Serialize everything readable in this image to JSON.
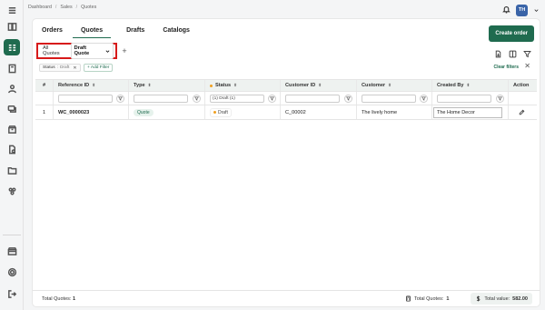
{
  "breadcrumb": {
    "items": [
      "Dashboard",
      "Sales",
      "Quotes"
    ]
  },
  "header": {
    "avatar_initials": "TH"
  },
  "tabs": [
    {
      "label": "Orders"
    },
    {
      "label": "Quotes"
    },
    {
      "label": "Drafts"
    },
    {
      "label": "Catalogs"
    }
  ],
  "create_button": "Create order",
  "views": {
    "all_label": "All Quotes",
    "selected_label": "Draft Quote"
  },
  "filters": {
    "chip_label": "Status",
    "chip_separator": ":",
    "chip_value": "Draft",
    "add_filter_label": "+ Add Filter",
    "clear_label": "Clear filters"
  },
  "table": {
    "columns": [
      "#",
      "Reference ID",
      "Type",
      "Status",
      "Customer ID",
      "Customer",
      "Created By",
      "Action"
    ],
    "status_filter_value": "(1) Draft (1)",
    "rows": [
      {
        "num": "1",
        "reference_id": "WC_0000023",
        "type": "Quote",
        "status": "Draft",
        "customer_id": "C_00002",
        "customer": "The lively home",
        "created_by": "The Home Decor"
      }
    ]
  },
  "footer": {
    "total_quotes_label": "Total Quotes:",
    "total_quotes_value": "1",
    "mid_label": "Total Quotes:",
    "mid_value": "1",
    "total_value_label": "Total value:",
    "total_value": "582.00"
  },
  "colors": {
    "accent": "#1f6b4f",
    "highlight_border": "#d71a1a",
    "status_draft": "#f0a020"
  },
  "icons": [
    "menu-icon",
    "catalog-icon",
    "orders-icon",
    "file-icon",
    "user-icon",
    "tag-icon",
    "box-icon",
    "document-icon",
    "folder-icon",
    "group-icon",
    "store-icon",
    "settings-icon",
    "logout-icon",
    "bell-icon",
    "chevron-down-icon",
    "export-icon",
    "columns-icon",
    "filter-icon",
    "edit-icon",
    "calculator-icon",
    "dollar-icon"
  ]
}
